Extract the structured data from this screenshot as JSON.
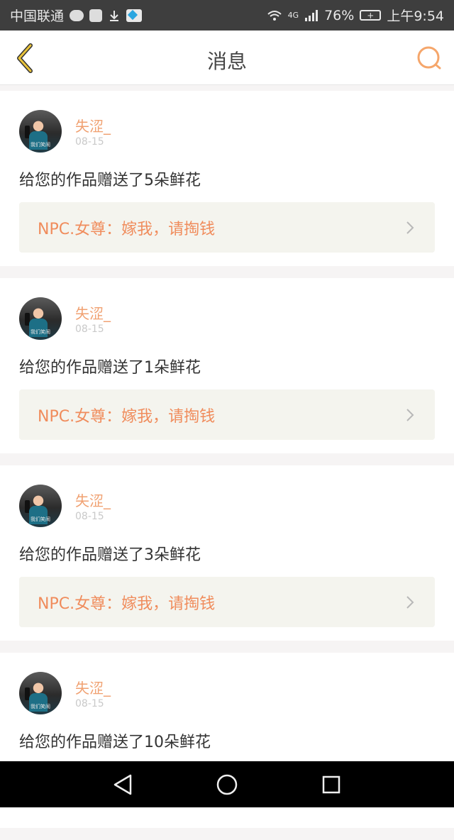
{
  "status_bar": {
    "carrier": "中国联通",
    "network": "4G",
    "battery": "76%",
    "battery_icon_label": "+",
    "time": "上午9:54",
    "icons": [
      "wechat-icon",
      "pet-app-icon",
      "download-icon",
      "video-app-icon",
      "wifi-icon",
      "signal-icon",
      "battery-icon"
    ]
  },
  "header": {
    "title": "消息",
    "back_icon": "chevron-left-icon",
    "search_icon": "search-icon",
    "accent_color": "#f5a66b",
    "back_color": "#e8c23a"
  },
  "avatar_caption": "我们笑闹",
  "messages": [
    {
      "name": "失涩_",
      "date": "08-15",
      "text": "给您的作品赠送了5朵鲜花",
      "quote": "NPC.女尊：嫁我，请掏钱"
    },
    {
      "name": "失涩_",
      "date": "08-15",
      "text": "给您的作品赠送了1朵鲜花",
      "quote": "NPC.女尊：嫁我，请掏钱"
    },
    {
      "name": "失涩_",
      "date": "08-15",
      "text": "给您的作品赠送了3朵鲜花",
      "quote": "NPC.女尊：嫁我，请掏钱"
    },
    {
      "name": "失涩_",
      "date": "08-15",
      "text": "给您的作品赠送了10朵鲜花",
      "quote": ""
    }
  ],
  "nav_bar": {
    "icons": [
      "back-triangle-icon",
      "home-circle-icon",
      "recents-square-icon"
    ]
  }
}
